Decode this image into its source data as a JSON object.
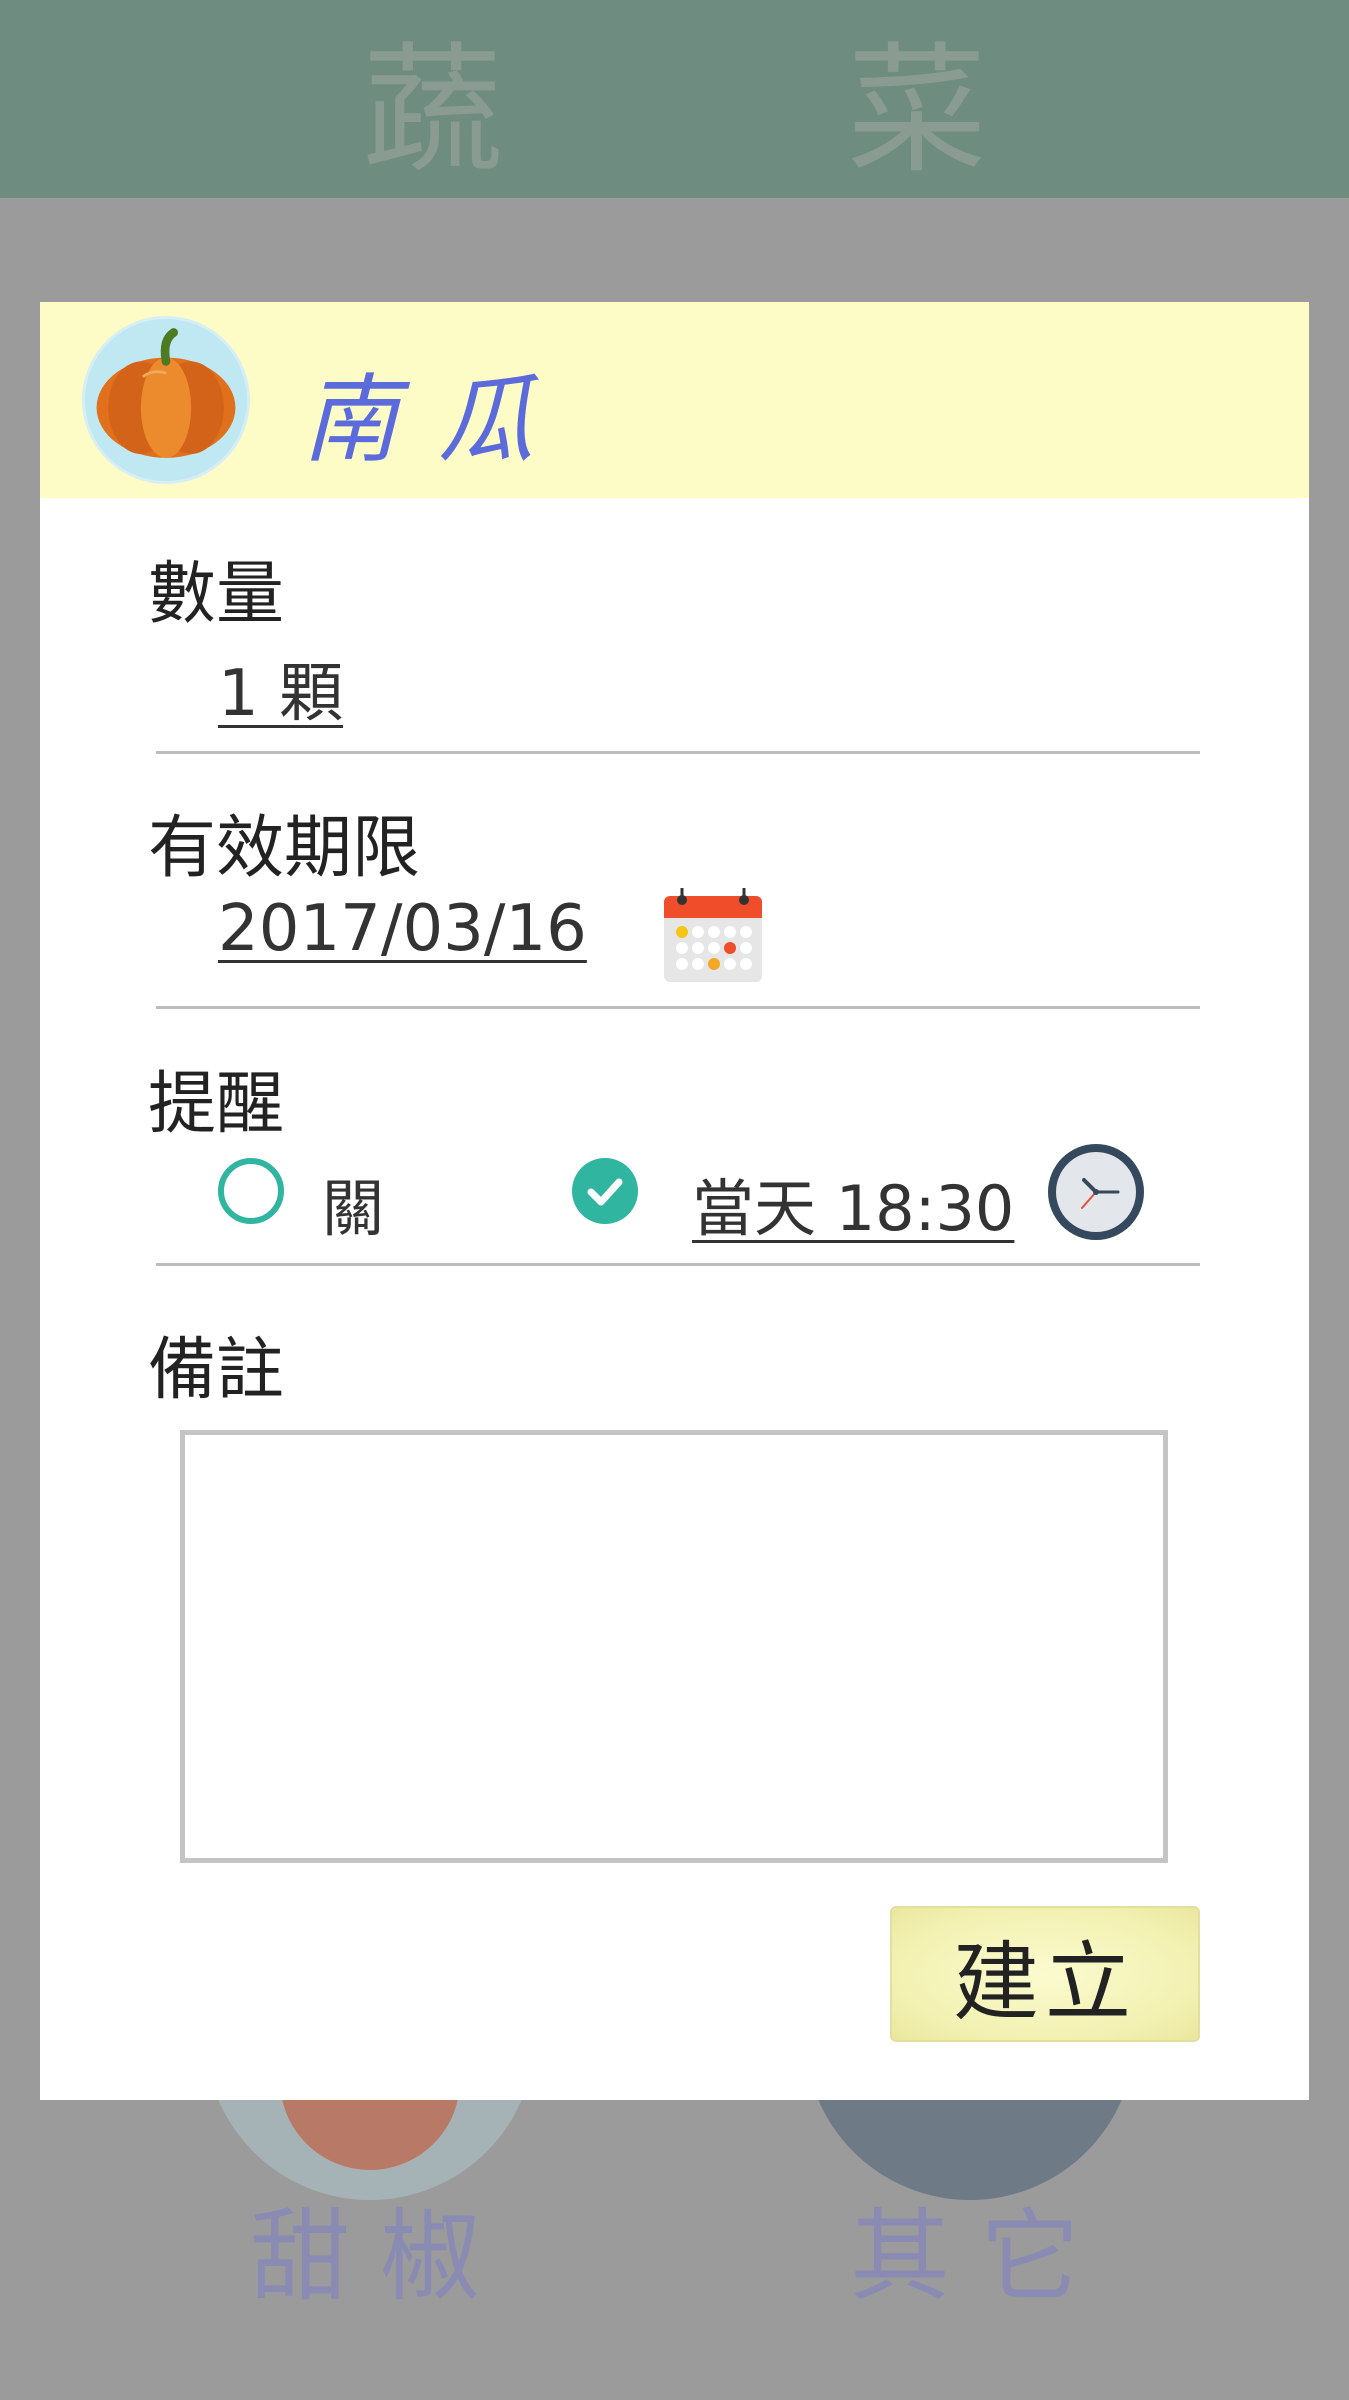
{
  "app": {
    "title": "蔬 菜",
    "background_tiles": [
      {
        "label": "甜椒"
      },
      {
        "label": "其它"
      }
    ]
  },
  "dialog": {
    "item_name": "南瓜",
    "item_icon": "pumpkin-icon",
    "quantity": {
      "label": "數量",
      "value": "1 顆"
    },
    "expiry": {
      "label": "有效期限",
      "value": "2017/03/16",
      "icon": "calendar-icon"
    },
    "reminder": {
      "label": "提醒",
      "off_label": "關",
      "on_value": "當天 18:30",
      "selected": "on",
      "icon": "clock-icon"
    },
    "notes": {
      "label": "備註",
      "value": ""
    },
    "create_label": "建立"
  },
  "colors": {
    "header_bg": "#6f8c80",
    "dialog_header_bg": "#fefcc6",
    "accent_teal": "#2fb5a0",
    "item_name": "#5b6bdb",
    "button_bg": "#f2f1b1"
  }
}
